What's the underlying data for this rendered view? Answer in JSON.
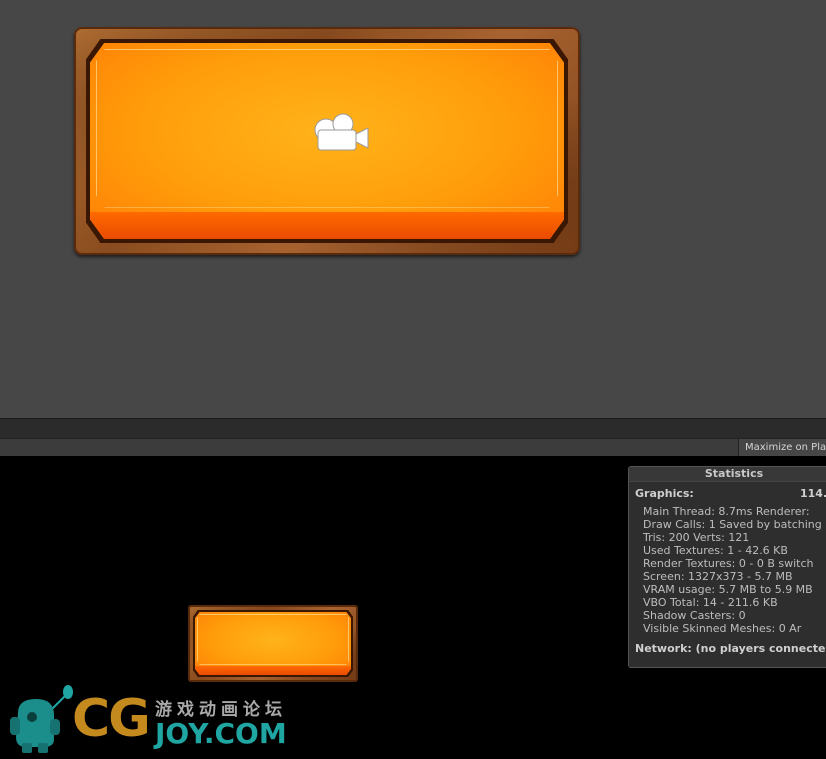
{
  "scene": {
    "camera_icon": "camera-icon"
  },
  "toolbar": {
    "maximize_label": "Maximize on Play"
  },
  "stats": {
    "title": "Statistics",
    "graphics_label": "Graphics:",
    "fps": "114.",
    "lines": [
      "Main Thread: 8.7ms  Renderer:",
      "Draw Calls: 1   Saved by batching",
      "Tris: 200  Verts: 121",
      "Used Textures: 1 - 42.6 KB",
      "Render Textures: 0 - 0 B  switch",
      "Screen: 1327x373 - 5.7 MB",
      "VRAM usage: 5.7 MB to 5.9 MB",
      "VBO Total: 14 - 211.6 KB",
      "Shadow Casters: 0",
      "Visible Skinned Meshes: 0      Ar"
    ],
    "network": "Network: (no players connected)"
  },
  "watermark": {
    "cg": "CG",
    "cn_text": "游戏动画论坛",
    "joy": "JOY.COM"
  },
  "colors": {
    "scene_bg": "#474747",
    "button_orange": "#ff9d0a",
    "frame_brown": "#8a4c1f",
    "watermark_gold": "#c58a1e",
    "watermark_teal": "#1fa6a3"
  }
}
